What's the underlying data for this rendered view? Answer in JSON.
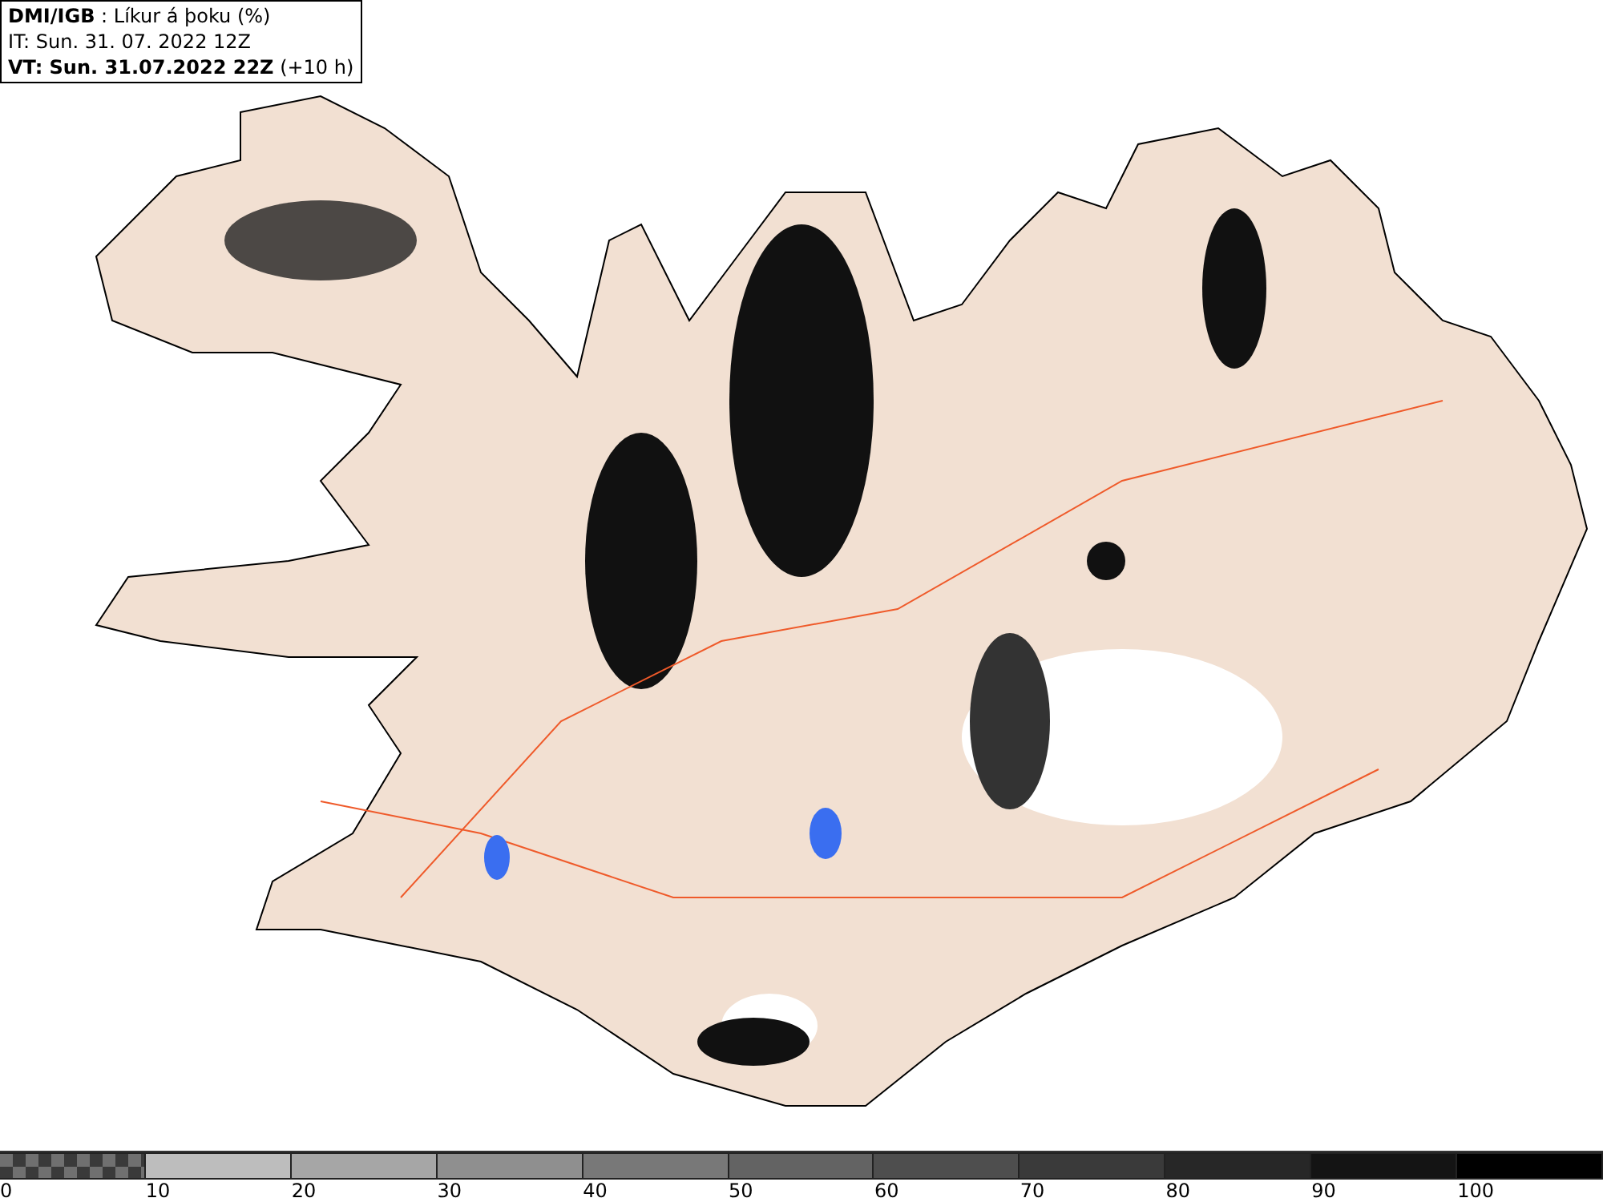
{
  "info_box": {
    "lines": [
      "**DMI/IGB** : Líkur á þoku (%)",
      "IT: Sun. 31. 07. 2022 12Z",
      "**VT: Sun. 31.07.2022 22Z** (+10 h)"
    ]
  },
  "legend": [
    {
      "label": "0",
      "kind": "checker"
    },
    {
      "label": "10",
      "kind": "solid",
      "color": "#bdbdbd"
    },
    {
      "label": "20",
      "kind": "solid",
      "color": "#a6a6a6"
    },
    {
      "label": "30",
      "kind": "solid",
      "color": "#8f8f8f"
    },
    {
      "label": "40",
      "kind": "solid",
      "color": "#787878"
    },
    {
      "label": "50",
      "kind": "solid",
      "color": "#636363"
    },
    {
      "label": "60",
      "kind": "solid",
      "color": "#4e4e4e"
    },
    {
      "label": "70",
      "kind": "solid",
      "color": "#3a3a3a"
    },
    {
      "label": "80",
      "kind": "solid",
      "color": "#272727"
    },
    {
      "label": "90",
      "kind": "solid",
      "color": "#141414"
    },
    {
      "label": "100",
      "kind": "solid",
      "color": "#000000"
    }
  ]
}
